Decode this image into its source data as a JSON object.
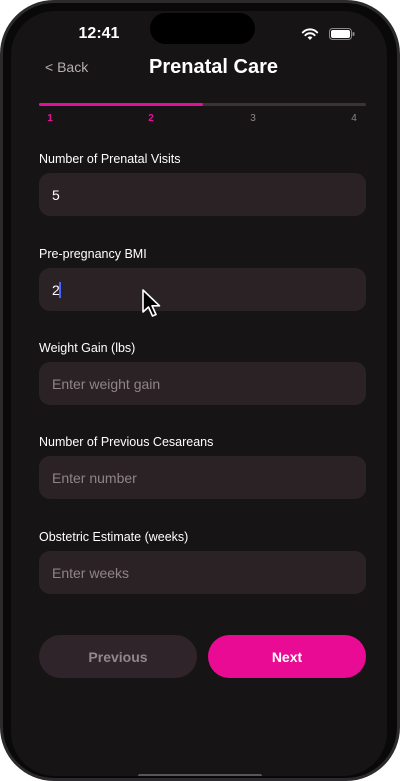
{
  "status_bar": {
    "time": "12:41",
    "icons": [
      "wifi-icon",
      "battery-icon"
    ]
  },
  "header": {
    "back_label": "< Back",
    "title": "Prenatal Care"
  },
  "progress": {
    "current_step": 2,
    "total_steps": 4,
    "fill_fraction": 0.5,
    "steps": [
      "1",
      "2",
      "3",
      "4"
    ]
  },
  "form": {
    "fields": [
      {
        "label": "Number of Prenatal Visits",
        "value": "5",
        "placeholder": ""
      },
      {
        "label": "Pre-pregnancy BMI",
        "value": "2",
        "placeholder": ""
      },
      {
        "label": "Weight Gain (lbs)",
        "value": "",
        "placeholder": "Enter weight gain"
      },
      {
        "label": "Number of Previous Cesareans",
        "value": "",
        "placeholder": "Enter number"
      },
      {
        "label": "Obstetric Estimate (weeks)",
        "value": "",
        "placeholder": "Enter weeks"
      }
    ]
  },
  "buttons": {
    "previous_label": "Previous",
    "next_label": "Next"
  },
  "colors": {
    "accent": "#e5109a",
    "background": "#171415",
    "input_background": "#2b2226"
  }
}
